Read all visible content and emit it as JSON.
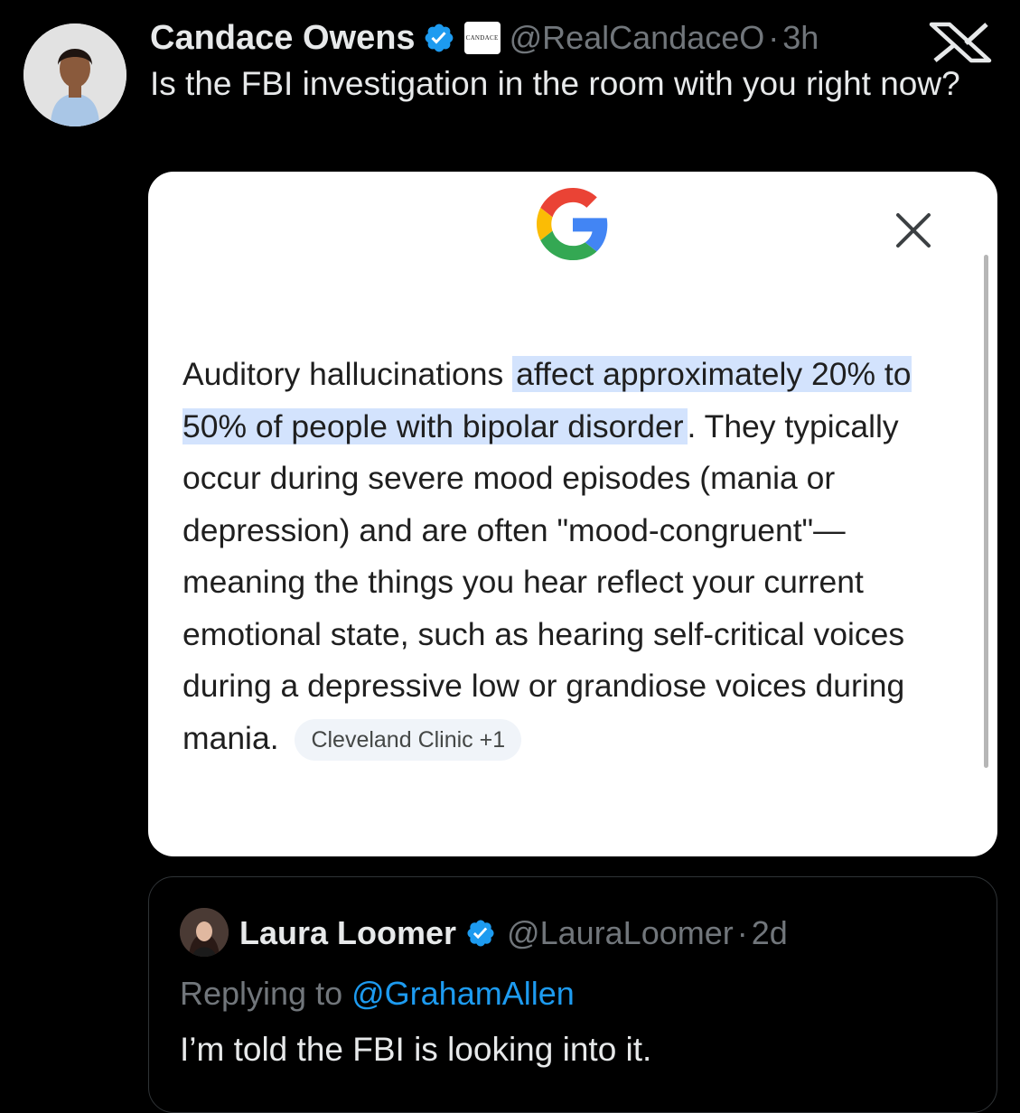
{
  "tweet": {
    "author_name": "Candace Owens",
    "affiliate_badge_text": "CANDACE",
    "handle": "@RealCandaceO",
    "separator": "·",
    "time": "3h",
    "text": "Is the FBI investigation in the room with you right now?",
    "verified_color": "#1d9bf0"
  },
  "media": {
    "answer_intro": "Auditory hallucinations ",
    "answer_highlight": "affect approximately 20% to 50% of people with bipolar disorder",
    "answer_body": ". They typically occur during severe mood episodes (mania or depression) and are often \"mood-congruent\"—meaning the things you hear reflect your current emotional state, such as hearing self-critical voices during a depressive low or grandiose voices during mania.",
    "source_chip": "Cleveland Clinic +1",
    "highlight_color": "#d3e3fd"
  },
  "quoted_tweet": {
    "author_name": "Laura Loomer",
    "handle": "@LauraLoomer",
    "separator": "·",
    "time": "2d",
    "replying_prefix": "Replying to ",
    "replying_to": "@GrahamAllen",
    "text": "I’m told the FBI is looking into it."
  },
  "icons": [
    "avatar",
    "verified-badge-icon",
    "x-logo-icon",
    "google-logo-icon",
    "close-icon"
  ]
}
